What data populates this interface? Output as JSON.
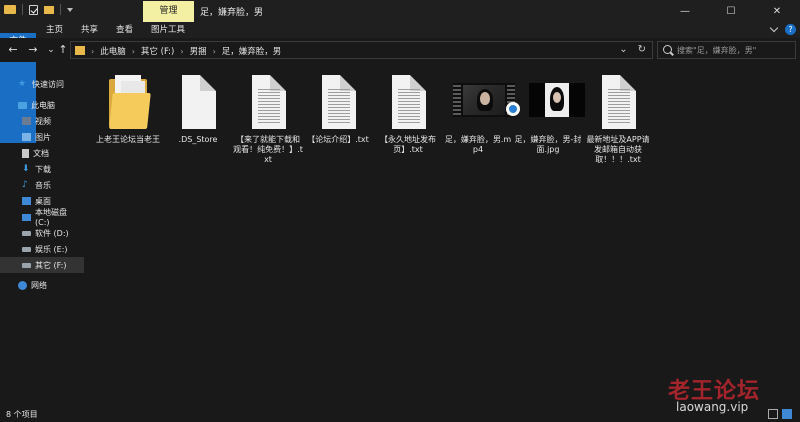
{
  "titlebar": {
    "context_tab": "管理",
    "title": "足，嫌弃脸，男",
    "minimize": "—",
    "maximize": "☐",
    "close": "✕"
  },
  "ribbon": {
    "tabs": [
      {
        "label": "文件",
        "active": true
      },
      {
        "label": "主页"
      },
      {
        "label": "共享"
      },
      {
        "label": "查看"
      },
      {
        "label": "图片工具"
      }
    ],
    "help": "?"
  },
  "nav": {
    "back": "←",
    "forward": "→",
    "dropdown": "⌄",
    "up": "↑",
    "breadcrumbs": [
      "此电脑",
      "其它 (F:)",
      "男捆",
      "足，嫌弃脸，男"
    ],
    "refresh": "↻",
    "search_placeholder": "搜索\"足，嫌弃脸，男\""
  },
  "sidebar": {
    "items": [
      {
        "label": "快速访问",
        "icon": "star-icon"
      },
      {
        "label": "此电脑",
        "icon": "pc-icon"
      },
      {
        "label": "视频",
        "icon": "video-icon"
      },
      {
        "label": "图片",
        "icon": "pictures-icon"
      },
      {
        "label": "文档",
        "icon": "documents-icon"
      },
      {
        "label": "下载",
        "icon": "download-icon"
      },
      {
        "label": "音乐",
        "icon": "music-icon"
      },
      {
        "label": "桌面",
        "icon": "desktop-icon"
      },
      {
        "label": "本地磁盘 (C:)",
        "icon": "drive-c-icon"
      },
      {
        "label": "软件 (D:)",
        "icon": "drive-icon"
      },
      {
        "label": "娱乐 (E:)",
        "icon": "drive-icon"
      },
      {
        "label": "其它 (F:)",
        "icon": "drive-icon",
        "selected": true
      },
      {
        "label": "网络",
        "icon": "network-icon"
      }
    ]
  },
  "files": [
    {
      "name": "上老王论坛当老王",
      "type": "folder"
    },
    {
      "name": ".DS_Store",
      "type": "blank"
    },
    {
      "name": "【来了就能下载和观看！纯免费！】.txt",
      "type": "txt"
    },
    {
      "name": "【论坛介绍】.txt",
      "type": "txt"
    },
    {
      "name": "【永久地址发布页】.txt",
      "type": "txt"
    },
    {
      "name": "足，嫌弃脸，男.mp4",
      "type": "video"
    },
    {
      "name": "足，嫌弃脸，男-封面.jpg",
      "type": "jpg"
    },
    {
      "name": "最新地址及APP请发邮箱自动获取！！！.txt",
      "type": "txt"
    }
  ],
  "status": {
    "item_count": "8 个项目"
  },
  "watermark": {
    "title": "老王论坛",
    "url": "laowang.vip"
  },
  "colors": {
    "accent": "#1a6fc4",
    "context_tab": "#f4f0a3",
    "folder": "#f5cb5c",
    "watermark": "#b3262e"
  }
}
